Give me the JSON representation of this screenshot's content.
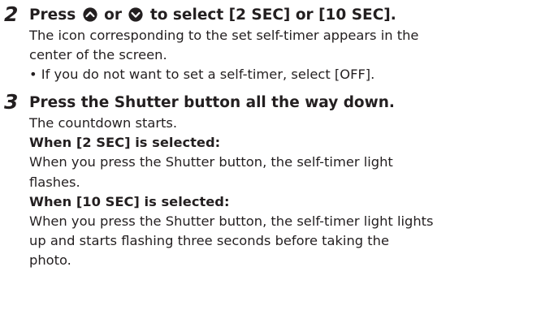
{
  "step2": {
    "number": "2",
    "heading_pre": "Press",
    "heading_mid": "or",
    "heading_post": "to select [2 SEC] or [10 SEC].",
    "icons": [
      "up-arrow-button-icon",
      "down-arrow-button-icon"
    ],
    "lines": [
      "The icon corresponding to the set self-timer appears in the",
      "center of the screen.",
      "• If you do not want to set a self-timer, select [OFF]."
    ]
  },
  "step3": {
    "number": "3",
    "heading": "Press the Shutter button all the way down.",
    "lines": [
      {
        "text": "The countdown starts.",
        "bold": false
      },
      {
        "text": "When [2 SEC] is selected:",
        "bold": true
      },
      {
        "text": "When you press the Shutter button, the self-timer light",
        "bold": false
      },
      {
        "text": "flashes.",
        "bold": false
      },
      {
        "text": "When [10 SEC] is selected:",
        "bold": true
      },
      {
        "text": "When you press the Shutter button, the self-timer light lights",
        "bold": false
      },
      {
        "text": "up and starts flashing three seconds before taking the",
        "bold": false
      },
      {
        "text": "photo.",
        "bold": false
      }
    ]
  }
}
